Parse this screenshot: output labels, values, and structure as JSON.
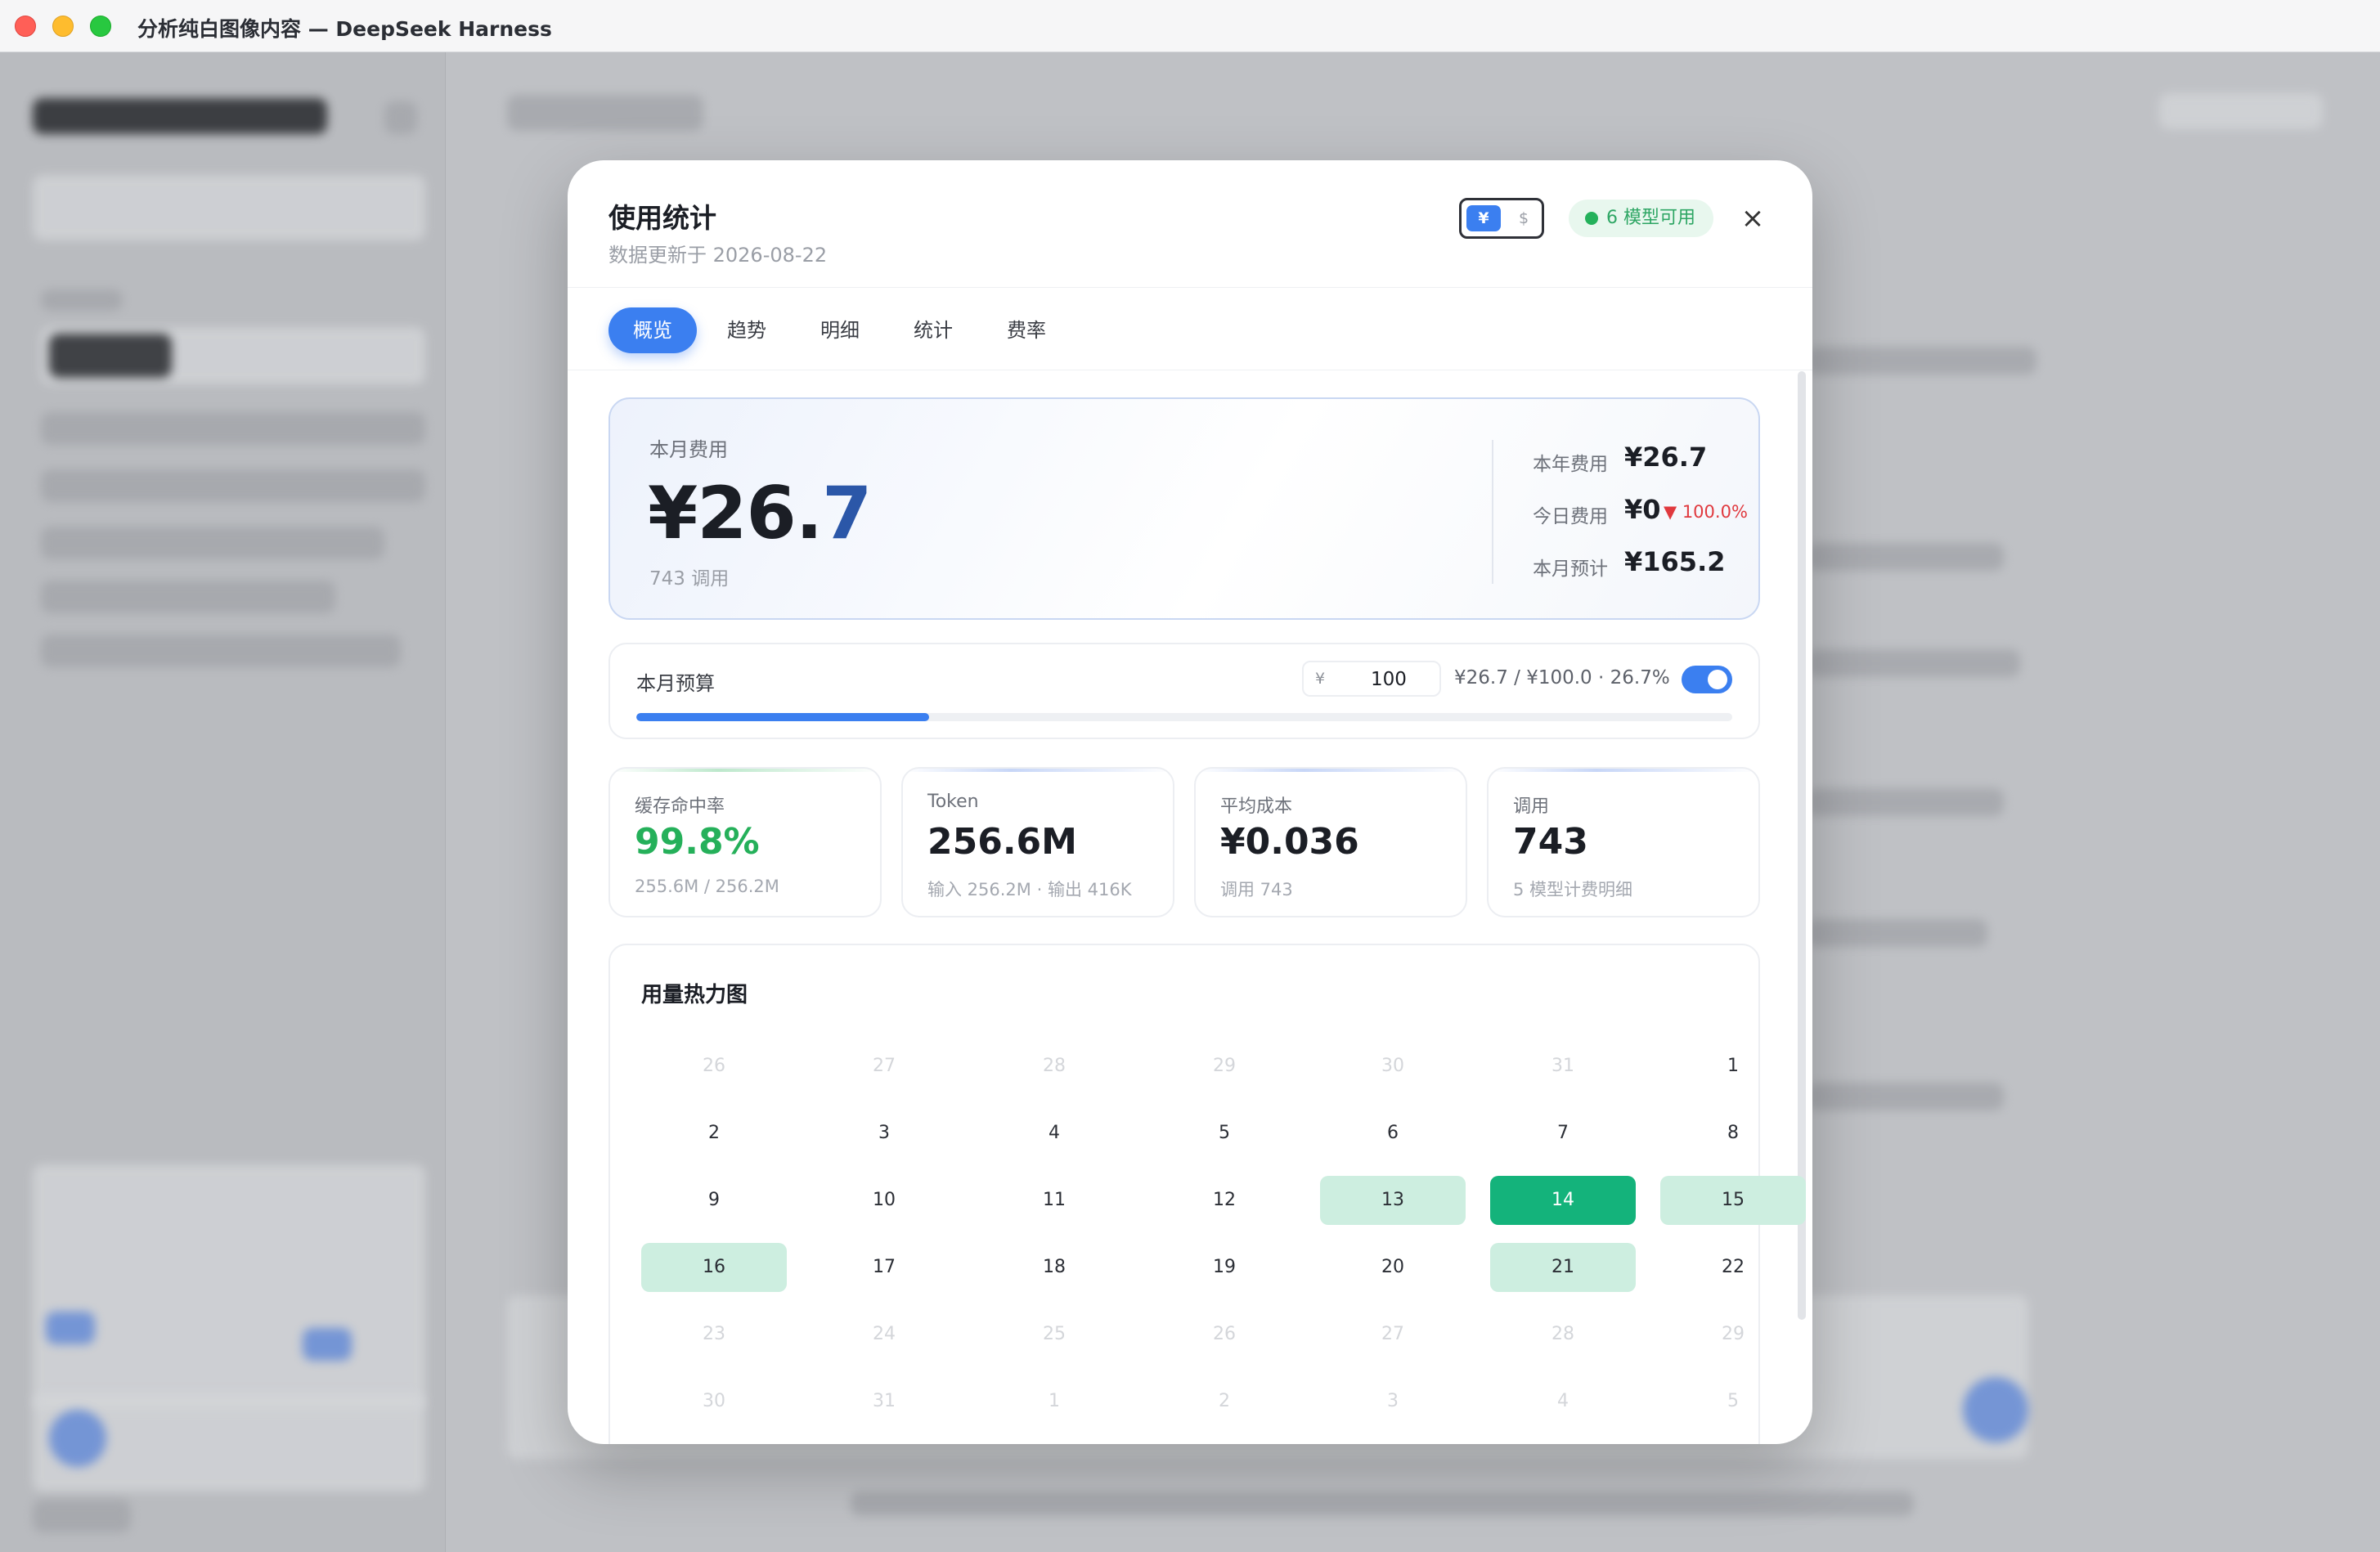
{
  "window": {
    "title": "分析纯白图像内容 — DeepSeek Harness"
  },
  "modal": {
    "title": "使用统计",
    "subtitle": "数据更新于 2026-08-22",
    "currency": {
      "yen": "¥",
      "usd": "$",
      "selected": "¥"
    },
    "status": "6 模型可用",
    "close": "×",
    "tabs": [
      "概览",
      "趋势",
      "明细",
      "统计",
      "费率"
    ],
    "active_tab": "概览"
  },
  "hero": {
    "label": "本月费用",
    "amount_int": "¥26.",
    "amount_dec": "7",
    "calls": "743 调用",
    "year_label": "本年费用",
    "year_value": "¥26.7",
    "today_label": "今日费用",
    "today_value": "¥0",
    "today_change": "▼ 100.0%",
    "forecast_label": "本月预计",
    "forecast_value": "¥165.2"
  },
  "budget": {
    "label": "本月预算",
    "currency_symbol": "¥",
    "amount": "100",
    "summary": "¥26.7 / ¥100.0 · 26.7%",
    "progress": 0.267,
    "enabled": true
  },
  "stats": [
    {
      "label": "缓存命中率",
      "value": "99.8%",
      "sub": "255.6M / 256.2M"
    },
    {
      "label": "Token",
      "value": "256.6M",
      "sub": "输入 256.2M · 输出 416K"
    },
    {
      "label": "平均成本",
      "value": "¥0.036",
      "sub": "调用 743"
    },
    {
      "label": "调用",
      "value": "743",
      "sub": "5 模型计费明细"
    }
  ],
  "heatmap": {
    "title": "用量热力图",
    "weeks": [
      [
        {
          "d": "26",
          "m": true
        },
        {
          "d": "27",
          "m": true
        },
        {
          "d": "28",
          "m": true
        },
        {
          "d": "29",
          "m": true
        },
        {
          "d": "30",
          "m": true
        },
        {
          "d": "31",
          "m": true
        },
        {
          "d": "1"
        }
      ],
      [
        {
          "d": "2"
        },
        {
          "d": "3"
        },
        {
          "d": "4"
        },
        {
          "d": "5"
        },
        {
          "d": "6"
        },
        {
          "d": "7"
        },
        {
          "d": "8"
        }
      ],
      [
        {
          "d": "9"
        },
        {
          "d": "10"
        },
        {
          "d": "11"
        },
        {
          "d": "12"
        },
        {
          "d": "13",
          "l": 1
        },
        {
          "d": "14",
          "l": 2
        },
        {
          "d": "15",
          "l": 1
        }
      ],
      [
        {
          "d": "16",
          "l": 1
        },
        {
          "d": "17"
        },
        {
          "d": "18"
        },
        {
          "d": "19"
        },
        {
          "d": "20"
        },
        {
          "d": "21",
          "l": 1
        },
        {
          "d": "22"
        }
      ],
      [
        {
          "d": "23",
          "m": true
        },
        {
          "d": "24",
          "m": true
        },
        {
          "d": "25",
          "m": true
        },
        {
          "d": "26",
          "m": true
        },
        {
          "d": "27",
          "m": true
        },
        {
          "d": "28",
          "m": true
        },
        {
          "d": "29",
          "m": true
        }
      ],
      [
        {
          "d": "30",
          "m": true
        },
        {
          "d": "31",
          "m": true
        },
        {
          "d": "1",
          "m": true
        },
        {
          "d": "2",
          "m": true
        },
        {
          "d": "3",
          "m": true
        },
        {
          "d": "4",
          "m": true
        },
        {
          "d": "5",
          "m": true
        }
      ]
    ]
  },
  "colors": {
    "accent": "#3b7ff0",
    "success": "#25b05a",
    "danger": "#e0393e",
    "heat_low": "#cdeee0",
    "heat_high": "#14b37b"
  }
}
